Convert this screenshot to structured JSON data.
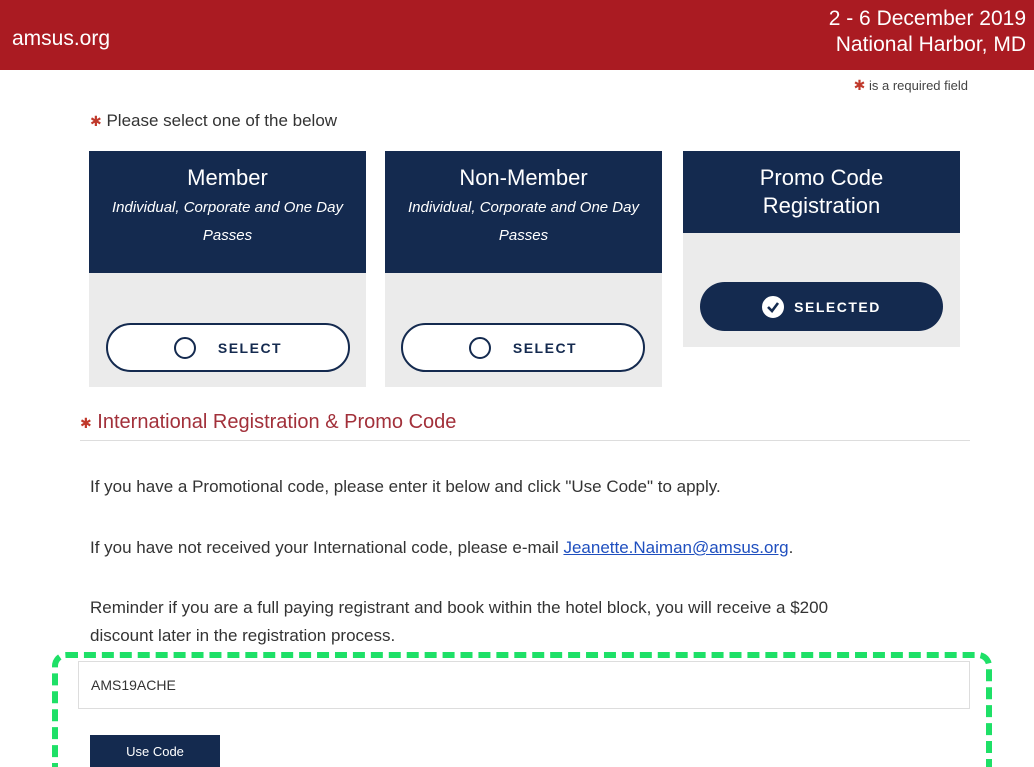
{
  "header": {
    "site_name": "amsus.org",
    "event_dates": "2 - 6 December 2019",
    "event_location": "National Harbor, MD"
  },
  "required_note": "is a required field",
  "select_prompt": "Please select one of the below",
  "options": [
    {
      "title": "Member",
      "subtitle": "Individual, Corporate and One Day Passes",
      "button_label": "SELECT",
      "selected": false
    },
    {
      "title": "Non-Member",
      "subtitle": "Individual, Corporate and One Day Passes",
      "button_label": "SELECT",
      "selected": false
    },
    {
      "title": "Promo Code Registration",
      "subtitle": "",
      "button_label": "SELECTED",
      "selected": true
    }
  ],
  "section": {
    "title": "International Registration & Promo Code",
    "para1": "If you have a Promotional code, please enter it below and click \"Use Code\" to apply.",
    "para2_prefix": "If you have not received your International code, please e-mail ",
    "email": "Jeanette.Naiman@amsus.org",
    "para2_suffix": ".",
    "para3": "Reminder if you are a full paying registrant and book within the hotel block, you will receive a $200 discount later in the registration process."
  },
  "promo": {
    "value": "AMS19ACHE",
    "button_label": "Use Code"
  },
  "colors": {
    "header_bg": "#aa1b22",
    "navy": "#142a4f",
    "highlight_dash": "#1ee067"
  },
  "icons": {
    "radio": "radio-empty-icon",
    "check": "check-circle-icon",
    "required": "asterisk-icon"
  }
}
